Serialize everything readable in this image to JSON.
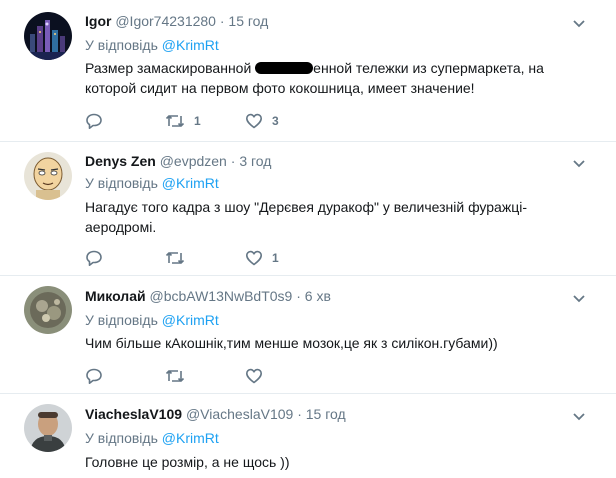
{
  "tweets": [
    {
      "name": "Igor",
      "handle": "@Igor74231280",
      "time": "15 год",
      "reply_label": "У відповідь",
      "reply_to": "@KrimRt",
      "text_before": "Размер замаскированной ",
      "text_after": "енной тележки из супермаркета, на которой сидит на первом фото кокошница, имеет значение!",
      "reply_count": "",
      "retweet_count": "1",
      "like_count": "3"
    },
    {
      "name": "Denys Zen",
      "handle": "@evpdzen",
      "time": "3 год",
      "reply_label": "У відповідь",
      "reply_to": "@KrimRt",
      "text": "Нагадує того кадра з шоу \"Дерєвея дуракоф\" у величезній фуражці-аеродромі.",
      "reply_count": "",
      "retweet_count": "",
      "like_count": "1"
    },
    {
      "name": "Миколай",
      "handle": "@bcbAW13NwBdT0s9",
      "time": "6 хв",
      "reply_label": "У відповідь",
      "reply_to": "@KrimRt",
      "text": "Чим більше кАкошнік,тим менше мозок,це як з силікон.губами))",
      "reply_count": "",
      "retweet_count": "",
      "like_count": ""
    },
    {
      "name": "ViacheslaV109",
      "handle": "@ViacheslaV109",
      "time": "15 год",
      "reply_label": "У відповідь",
      "reply_to": "@KrimRt",
      "text": "Головне це розмір, а не щось ))",
      "reply_count": "",
      "retweet_count": "",
      "like_count": ""
    }
  ],
  "separator": "·",
  "icons": [
    "reply-icon",
    "retweet-icon",
    "like-icon",
    "chevron-down-icon"
  ],
  "colors": {
    "link": "#1da1f2",
    "muted": "#657786",
    "text": "#14171a",
    "divider": "#e6ecf0"
  }
}
